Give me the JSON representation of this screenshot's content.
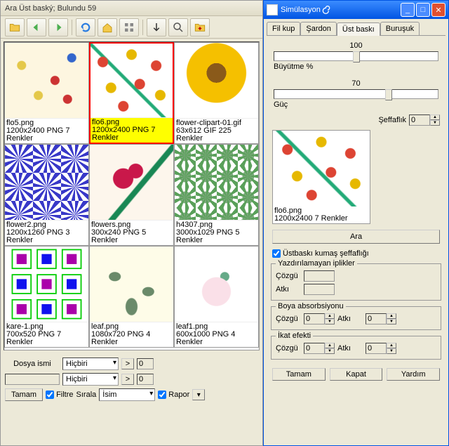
{
  "main": {
    "title": "Ara Üst baský; Bulundu 59",
    "cells": [
      {
        "name": "flo5.png",
        "info": "1200x2400 PNG 7 Renkler",
        "cls": "flo5",
        "sel": false
      },
      {
        "name": "flo6.png",
        "info": "1200x2400 PNG 7 Renkler",
        "cls": "flo6",
        "sel": true
      },
      {
        "name": "flower-clipart-01.gif",
        "info": "63x612 GIF 225 Renkler",
        "cls": "sunflower",
        "sel": false
      },
      {
        "name": "flower2.png",
        "info": "1200x1260 PNG 3 Renkler",
        "cls": "flower2",
        "sel": false
      },
      {
        "name": "flowers.png",
        "info": "300x240 PNG 5 Renkler",
        "cls": "flowers",
        "sel": false
      },
      {
        "name": "h4307.png",
        "info": "3000x1029 PNG 5 Renkler",
        "cls": "h4307",
        "sel": false
      },
      {
        "name": "kare-1.png",
        "info": "700x520 PNG 7 Renkler",
        "cls": "kare1",
        "sel": false
      },
      {
        "name": "leaf.png",
        "info": "1080x720 PNG 4 Renkler",
        "cls": "leaf",
        "sel": false
      },
      {
        "name": "leaf1.png",
        "info": "600x1000 PNG 4 Renkler",
        "cls": "leaf1",
        "sel": false
      }
    ],
    "bottom": {
      "file_label": "Dosya ismi",
      "none": "Hiçbiri",
      "gt": ">",
      "zero": "0",
      "ok": "Tamam",
      "filter": "Filtre",
      "sort": "Sırala",
      "name": "İsim",
      "report": "Rapor"
    }
  },
  "sim": {
    "title": "Simülasyon",
    "tabs": [
      "Fil kup",
      "Şardon",
      "Üst baskı",
      "Buruşuk"
    ],
    "active_tab": 2,
    "zoom_val": "100",
    "zoom_label": "Büyütme %",
    "power_val": "70",
    "power_label": "Güç",
    "transp_label": "Şeffaflık",
    "transp_val": "0",
    "preview_name": "flo6.png",
    "preview_info": "1200x2400  7 Renkler",
    "search": "Ara",
    "overprint_chk": "Üstbaskı kumaş şeffaflığı",
    "group1": {
      "title": "Yazdırılamayan iplikler",
      "warp": "Çözgü",
      "weft": "Atkı"
    },
    "group2": {
      "title": "Boya absorbsiyonu",
      "warp": "Çözgü",
      "wval": "0",
      "weft": "Atkı",
      "fval": "0"
    },
    "group3": {
      "title": "İkat efekti",
      "warp": "Çözgü",
      "wval": "0",
      "weft": "Atkı",
      "fval": "0"
    },
    "btns": {
      "ok": "Tamam",
      "close": "Kapat",
      "help": "Yardım"
    }
  }
}
